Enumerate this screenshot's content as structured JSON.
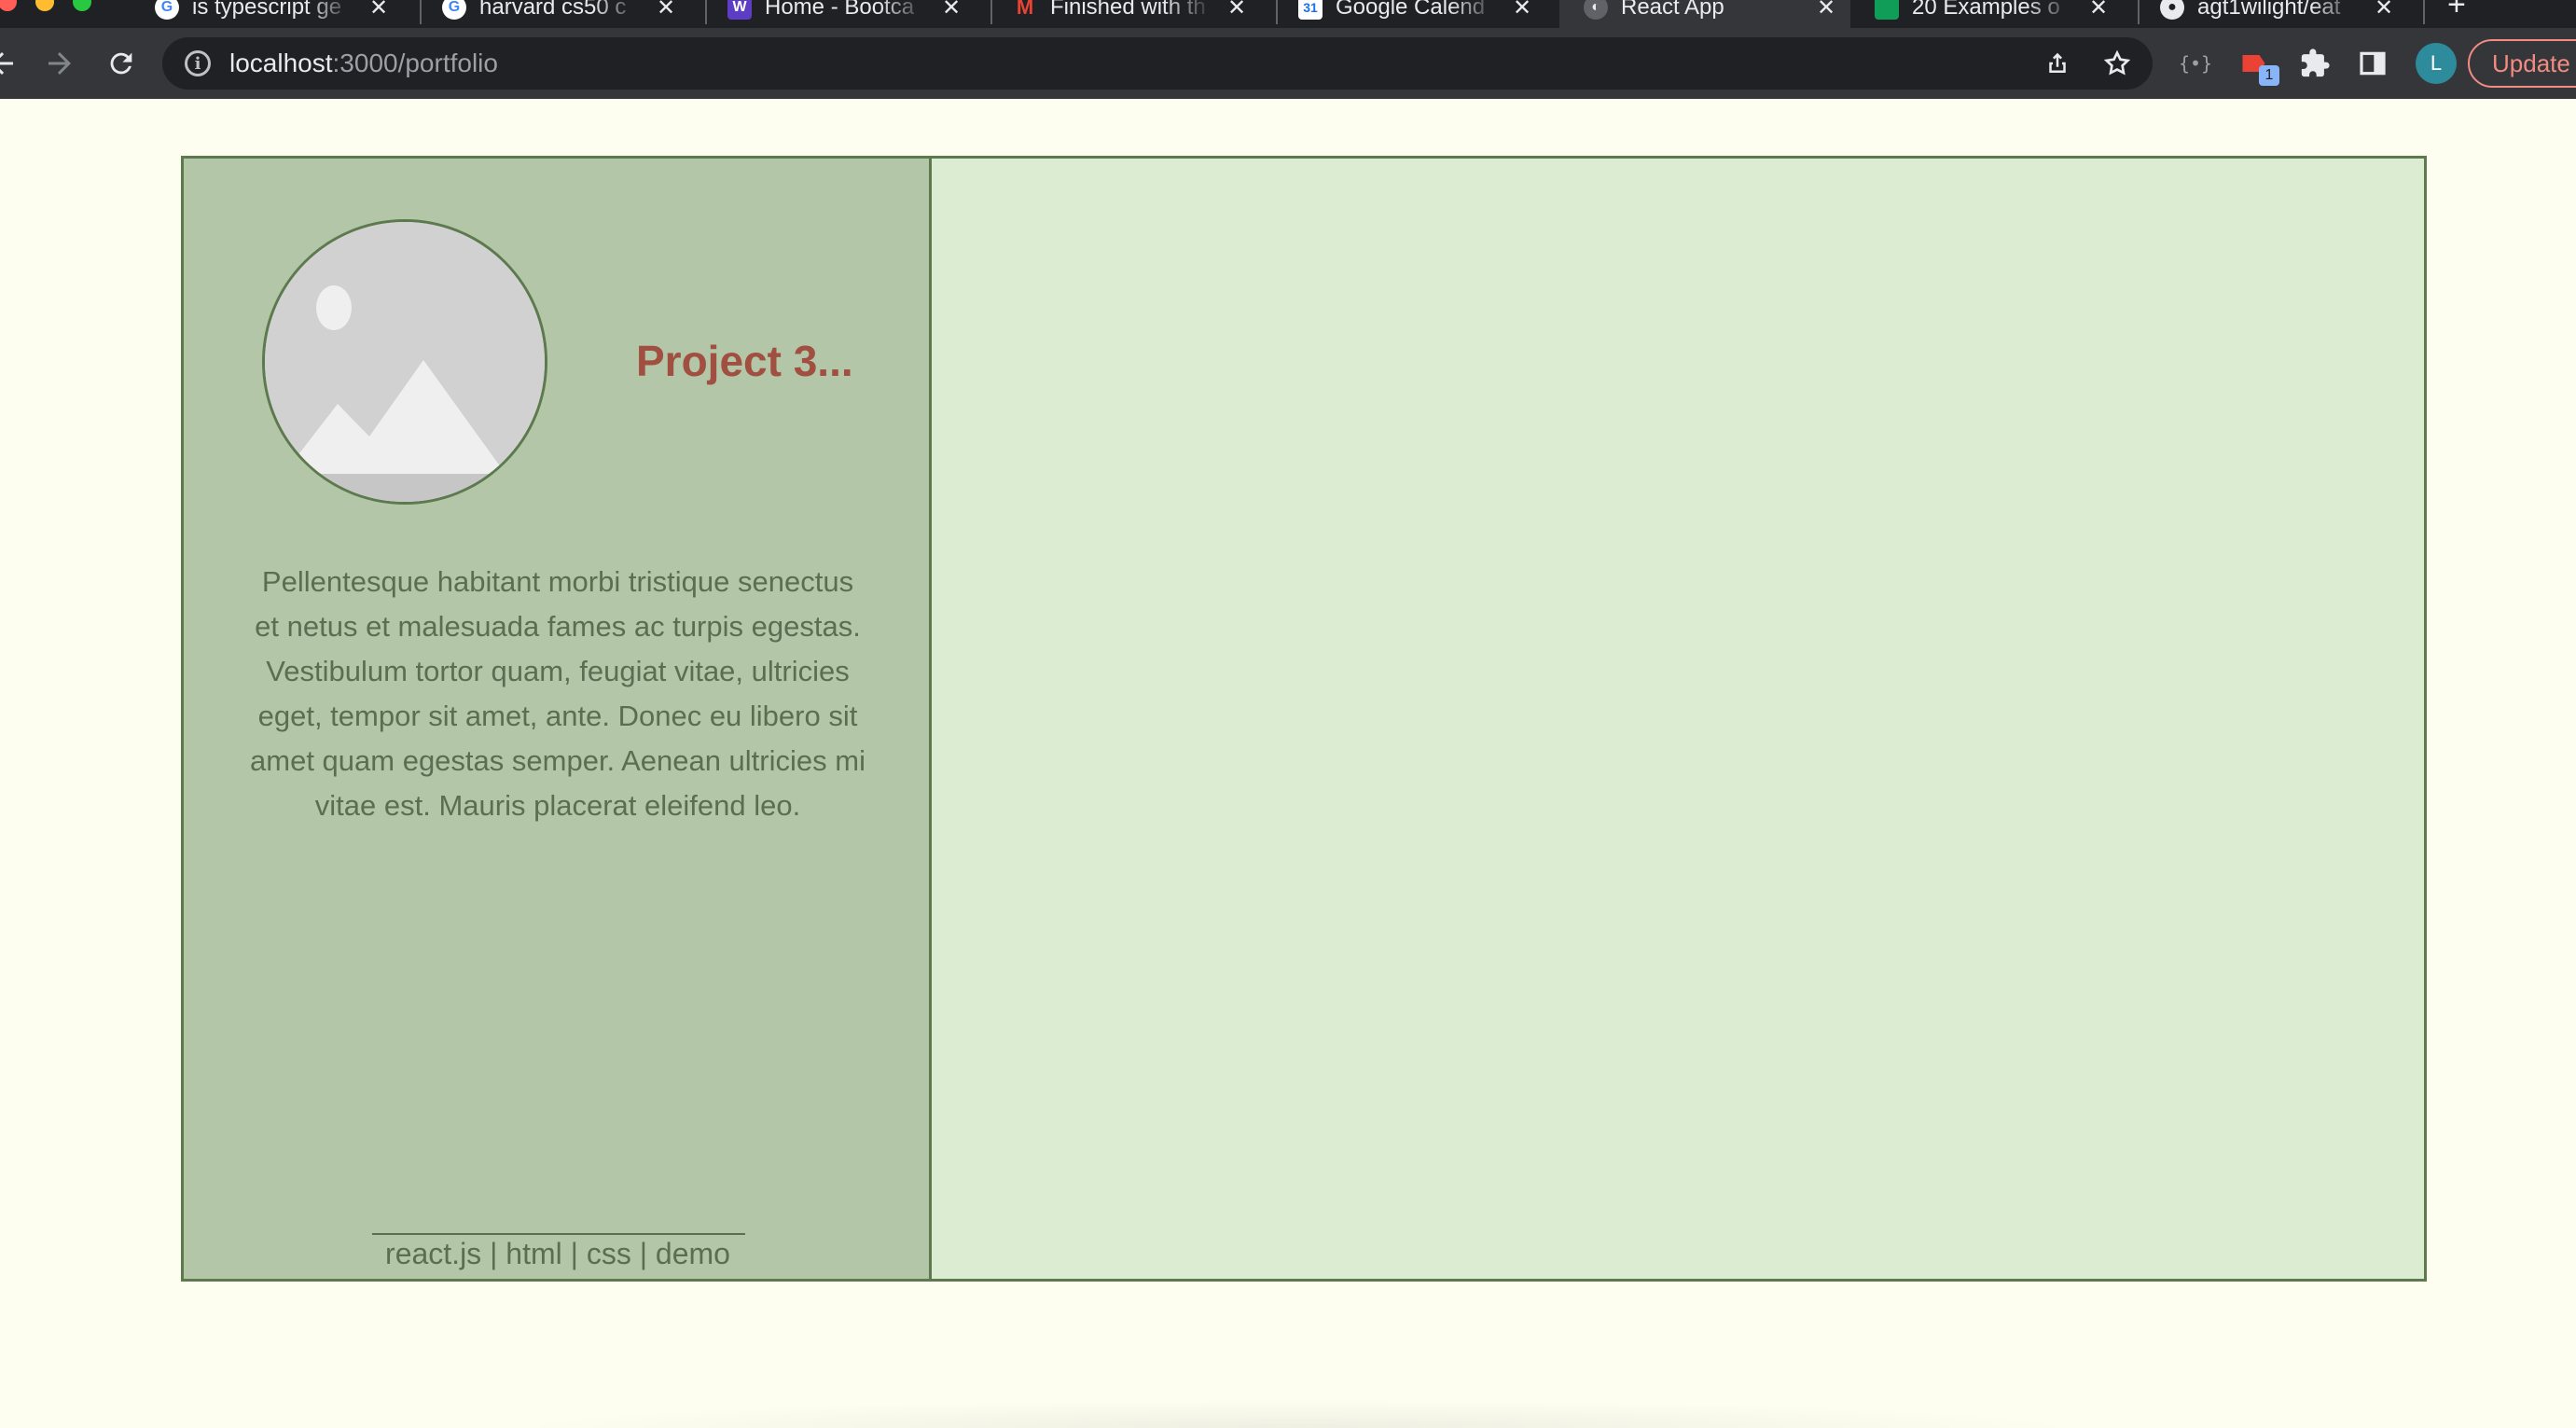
{
  "browser": {
    "tabs": [
      {
        "title": "is typescript ge",
        "favicon": "google-icon",
        "color": "#4285f4"
      },
      {
        "title": "harvard cs50 c",
        "favicon": "google-icon",
        "color": "#4285f4"
      },
      {
        "title": "Home - Bootca",
        "favicon": "w-icon",
        "color": "#5c3dc4"
      },
      {
        "title": "Finished with th",
        "favicon": "gmail-icon",
        "color": "#ea4335"
      },
      {
        "title": "Google Calend",
        "favicon": "calendar-icon",
        "color": "#1a73e8"
      },
      {
        "title": "React App",
        "favicon": "globe-icon",
        "color": "#9aa0a6",
        "active": true
      },
      {
        "title": "20 Examples o",
        "favicon": "sheet-icon",
        "color": "#0f9d58"
      },
      {
        "title": "agt1wilight/eat",
        "favicon": "github-icon",
        "color": "#e8eaed"
      }
    ],
    "url_host": "localhost",
    "url_path": ":3000/portfolio",
    "profile_initial": "L",
    "extension_badge": "1",
    "update_label": "Update",
    "colors": {
      "tabstrip": "#202124",
      "toolbar": "#35363a",
      "accent": "#f28b82"
    }
  },
  "project": {
    "title": "Project 3...",
    "description": "Pellentesque habitant morbi tristique senectus et netus et malesuada fames ac turpis egestas. Vestibulum tortor quam, feugiat vitae, ultricies eget, tempor sit amet, ante. Donec eu libero sit amet quam egestas semper. Aenean ultricies mi vitae est. Mauris placerat eleifend leo.",
    "tech": [
      "react.js",
      "html",
      "css",
      "demo"
    ],
    "tech_separator": " | ",
    "image_icon": "image-placeholder-icon"
  },
  "theme": {
    "page_bg": "#fdfdf0",
    "card_left_bg": "#b3c7a8",
    "card_right_bg": "#dcecd2",
    "border": "#5d7a4e",
    "title_color": "#a04f40",
    "text_color": "#5a6e52"
  }
}
